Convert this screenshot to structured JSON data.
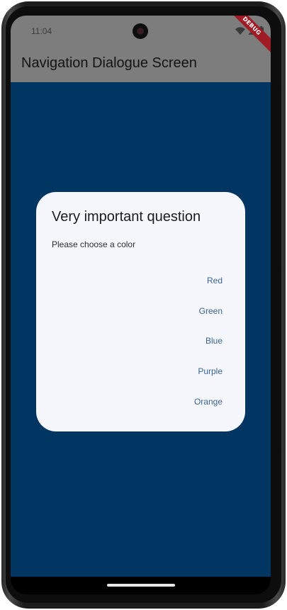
{
  "status_bar": {
    "time": "11:04",
    "debug_label": "DEBUG"
  },
  "app_bar": {
    "title": "Navigation Dialogue Screen"
  },
  "dialog": {
    "title": "Very important question",
    "content": "Please choose a color",
    "options": [
      {
        "label": "Red"
      },
      {
        "label": "Green"
      },
      {
        "label": "Blue"
      },
      {
        "label": "Purple"
      },
      {
        "label": "Orange"
      }
    ]
  },
  "colors": {
    "background": "#003661",
    "scrim_app_bar": "#7d7d7d",
    "dialog_surface": "#f6f7fd",
    "option_text": "#3a6492",
    "debug_banner": "#a01c24"
  },
  "icons": {
    "status": [
      "wifi-icon",
      "signal-icon",
      "battery-icon"
    ]
  }
}
